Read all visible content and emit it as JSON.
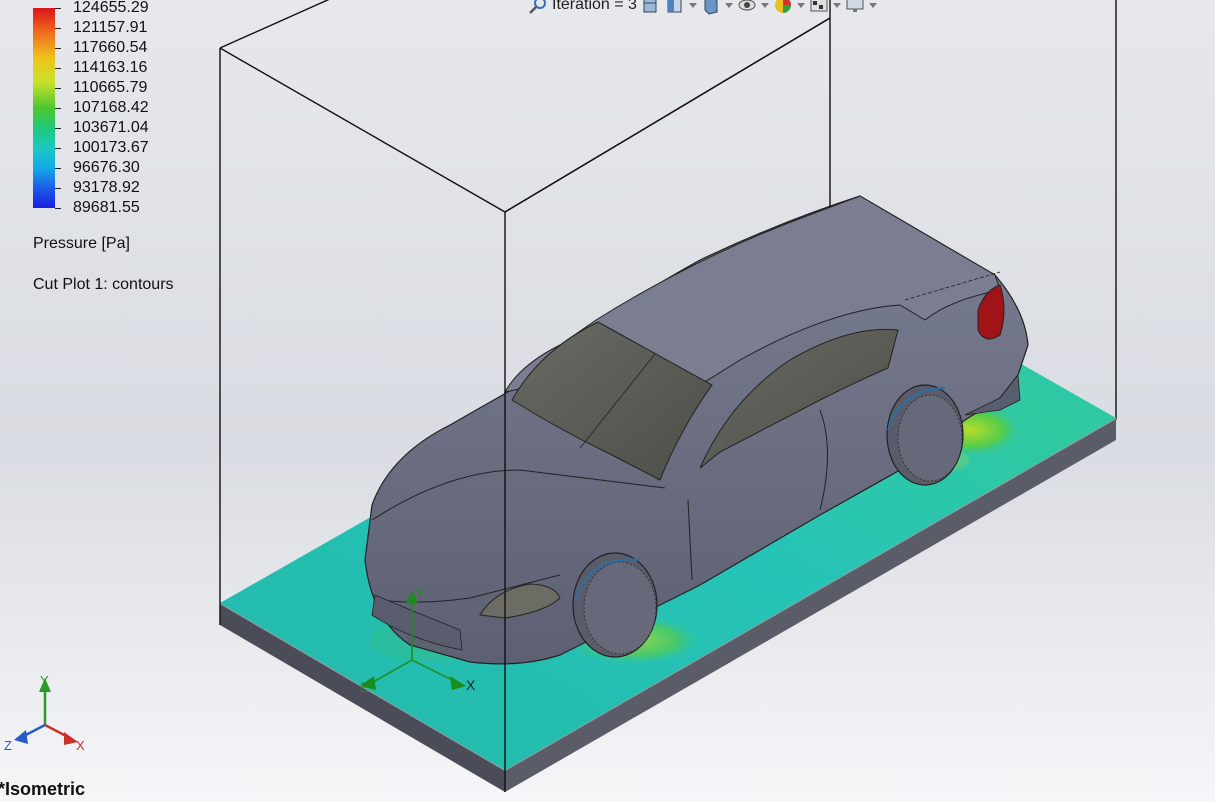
{
  "legend": {
    "values": [
      "124655.29",
      "121157.91",
      "117660.54",
      "114163.16",
      "110665.79",
      "107168.42",
      "103671.04",
      "100173.67",
      "96676.30",
      "93178.92",
      "89681.55"
    ],
    "title": "Pressure [Pa]",
    "plot_name": "Cut Plot 1: contours"
  },
  "toolbar": {
    "iteration_label": "Iteration = 3",
    "icons": [
      "zoom-icon",
      "iteration-icon",
      "section-view-icon",
      "display-style-icon",
      "hide-show-icon",
      "appearance-icon",
      "scene-icon",
      "monitor-icon"
    ]
  },
  "view": {
    "name": "*Isometric"
  },
  "triad": {
    "x": "X",
    "y": "Y",
    "z": "Z"
  },
  "colors": {
    "contour_low": "#1a1ee0",
    "contour_mid": "#1bc9c3",
    "contour_high": "#d9141b",
    "car_body": "#6f7385"
  }
}
